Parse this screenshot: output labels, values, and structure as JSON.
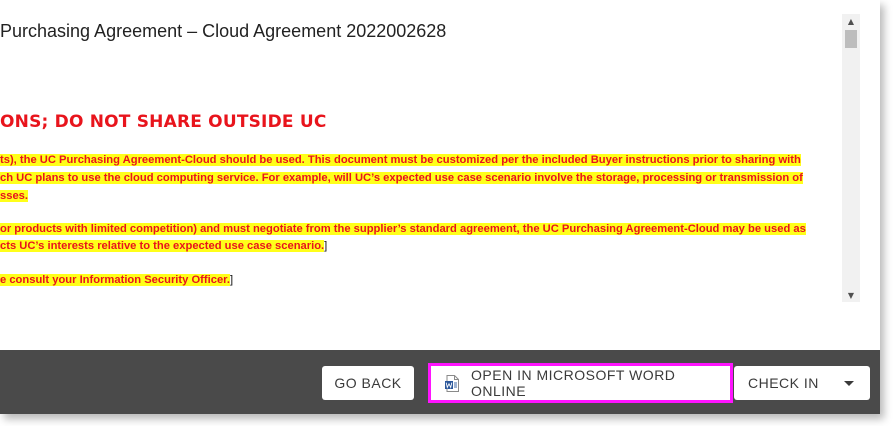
{
  "document": {
    "title": "Purchasing Agreement – Cloud Agreement 2022002628",
    "heading": "ONS; DO NOT SHARE OUTSIDE UC",
    "lines": [
      {
        "text": "ts), the UC Purchasing Agreement-Cloud should be used. This document must be customized per the included Buyer instructions prior to sharing with",
        "trail": ""
      },
      {
        "text": "ch UC plans to use the cloud computing service.  For example, will UC’s expected use case scenario involve the storage, processing or transmission of",
        "trail": ""
      },
      {
        "text": "sses.",
        "trail": ""
      },
      {
        "text": "or products with limited competition) and must negotiate from the supplier’s standard agreement, the UC Purchasing Agreement-Cloud may be used as",
        "trail": ""
      },
      {
        "text": "cts UC’s interests relative to the expected use case scenario.",
        "trail": "]"
      },
      {
        "text": "e consult your Information Security Officer.",
        "trail": "]"
      }
    ]
  },
  "scrollbar": {
    "up_glyph": "▲",
    "down_glyph": "▼"
  },
  "toolbar": {
    "go_back_label": "GO BACK",
    "open_word_label": "OPEN IN MICROSOFT WORD ONLINE",
    "check_in_label": "CHECK IN"
  },
  "icons": {
    "word": "word-document-icon",
    "dropdown": "chevron-down-icon"
  },
  "colors": {
    "doc_red": "#e8141c",
    "highlight_yellow": "#ffff1a",
    "toolbar_bg": "#4a4a4a",
    "focus_magenta": "#ff13ff",
    "word_blue": "#2b579a"
  }
}
